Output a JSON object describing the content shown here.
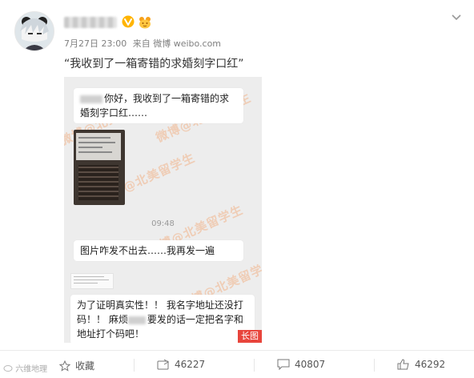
{
  "post": {
    "timestamp": "7月27日 23:00",
    "source": "来自 微博 weibo.com",
    "text": "“我收到了一箱寄错的求婚刻字口红”"
  },
  "screenshot": {
    "bubble1_text": "你好，我收到了一箱寄错的求婚刻字口红……",
    "time": "09:48",
    "bubble2_text": "图片咋发不出去……我再发一遍",
    "bubble3_part1": "为了证明真实性！！ 我名字地址还没打码！！ 麻烦",
    "bubble3_part2": "要发的话一定把名字和地址打个码吧！",
    "long_image_tag": "长图",
    "watermark": "微博@北美留学生"
  },
  "actions": {
    "favorite_label": "收藏",
    "forward_count": "46227",
    "comment_count": "40807",
    "like_count": "46292"
  },
  "footnote": "六维地理"
}
